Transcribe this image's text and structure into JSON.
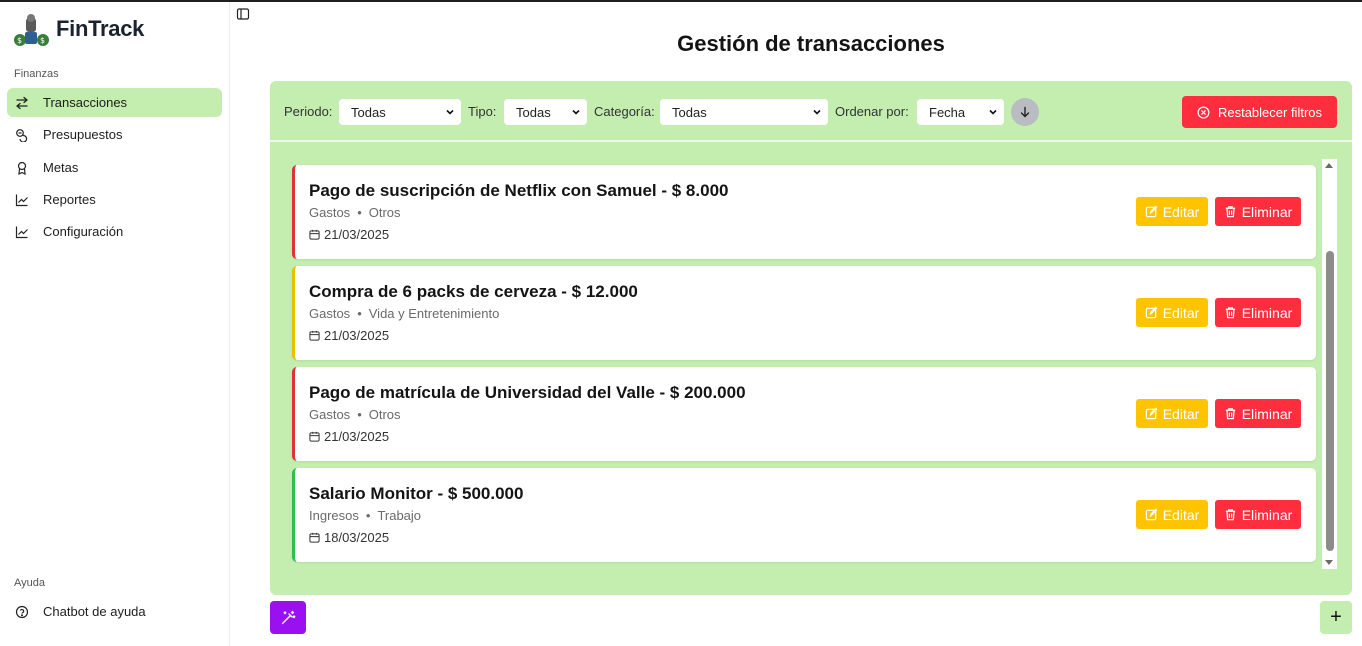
{
  "app": {
    "name": "FinTrack"
  },
  "sidebar": {
    "section_finanzas": "Finanzas",
    "items": [
      {
        "label": "Transacciones",
        "icon": "arrows-left-right-icon",
        "active": true
      },
      {
        "label": "Presupuestos",
        "icon": "coins-icon",
        "active": false
      },
      {
        "label": "Metas",
        "icon": "award-icon",
        "active": false
      },
      {
        "label": "Reportes",
        "icon": "chart-line-icon",
        "active": false
      },
      {
        "label": "Configuración",
        "icon": "chart-line-icon",
        "active": false
      }
    ],
    "section_ayuda": "Ayuda",
    "help_item": {
      "label": "Chatbot de ayuda",
      "icon": "help-circle-icon"
    }
  },
  "page": {
    "title": "Gestión de transacciones"
  },
  "filters": {
    "periodo_label": "Periodo:",
    "periodo_value": "Todas",
    "tipo_label": "Tipo:",
    "tipo_value": "Todas",
    "categoria_label": "Categoría:",
    "categoria_value": "Todas",
    "ordenar_label": "Ordenar por:",
    "ordenar_value": "Fecha",
    "reset_label": "Restablecer filtros"
  },
  "transactions": [
    {
      "title": "Pago de suscripción de Netflix con Samuel - $ 8.000",
      "type": "Gastos",
      "category": "Otros",
      "date": "21/03/2025",
      "accent": "#e0303a"
    },
    {
      "title": "Compra de 6 packs de cerveza - $ 12.000",
      "type": "Gastos",
      "category": "Vida y Entretenimiento",
      "date": "21/03/2025",
      "accent": "#e6c200"
    },
    {
      "title": "Pago de matrícula de Universidad del Valle - $ 200.000",
      "type": "Gastos",
      "category": "Otros",
      "date": "21/03/2025",
      "accent": "#e0303a"
    },
    {
      "title": "Salario Monitor - $ 500.000",
      "type": "Ingresos",
      "category": "Trabajo",
      "date": "18/03/2025",
      "accent": "#2ec04a"
    }
  ],
  "actions": {
    "edit_label": "Editar",
    "delete_label": "Eliminar",
    "meta_separator": "•",
    "add_symbol": "+"
  },
  "colors": {
    "primary_green": "#c3eeaf",
    "danger": "#ff2e3e",
    "warning": "#ffc400",
    "magic": "#9b10f0"
  }
}
